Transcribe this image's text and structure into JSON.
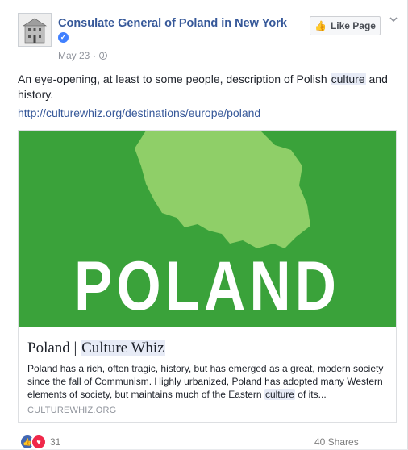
{
  "post": {
    "page_name": "Consulate General of Poland in New York",
    "date": "May 23",
    "separator": "·",
    "like_button_label": "Like Page",
    "text_before": "An eye-opening, at least to some people, description of Polish ",
    "text_highlight": "culture",
    "text_after": " and history.",
    "link_url": "http://culturewhiz.org/destinations/europe/poland"
  },
  "link_preview": {
    "hero_text": "POLAND",
    "title_prefix": "Poland | ",
    "title_highlight": "Culture Whiz",
    "description_before": "Poland has a rich, often tragic, history, but has emerged as a great, modern society since the fall of Communism. Highly urbanized, Poland has adopted many Western elements of society, but maintains much of the Eastern ",
    "description_highlight": "culture",
    "description_after": " of its...",
    "domain": "CULTUREWHIZ.ORG"
  },
  "footer": {
    "reaction_count": "31",
    "shares": "40 Shares"
  },
  "colors": {
    "hero_green": "#3aa23a",
    "map_green": "#8fcf68",
    "link_blue": "#365899"
  },
  "icons": [
    "verified-badge-icon",
    "globe-icon",
    "thumbs-up-icon",
    "chevron-down-icon",
    "like-reaction-icon",
    "love-reaction-icon"
  ]
}
